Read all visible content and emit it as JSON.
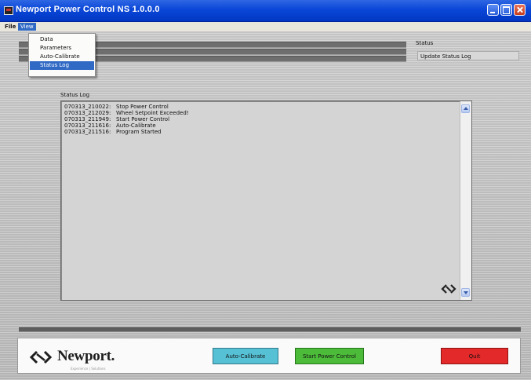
{
  "window": {
    "title": "Newport Power Control NS 1.0.0.0"
  },
  "menubar": {
    "file": "File",
    "view": "View"
  },
  "view_menu": {
    "items": [
      "Data",
      "Parameters",
      "Auto-Calibrate",
      "Status Log"
    ],
    "selected": "Status Log"
  },
  "status": {
    "label": "Status",
    "value": "Update Status Log"
  },
  "status_log": {
    "label": "Status Log",
    "entries": [
      {
        "time": "070313_210022:",
        "message": "Stop Power Control"
      },
      {
        "time": "070313_212029:",
        "message": "Wheel Setpoint Exceeded!"
      },
      {
        "time": "070313_211949:",
        "message": "Start Power Control"
      },
      {
        "time": "070313_211616:",
        "message": "Auto-Calibrate"
      },
      {
        "time": "070313_211516:",
        "message": "Program Started"
      }
    ]
  },
  "brand": {
    "name": "Newport.",
    "tagline": "Experience | Solutions"
  },
  "buttons": {
    "auto_calibrate": "Auto-Calibrate",
    "start_power_control": "Start Power Control",
    "quit": "Quit"
  },
  "colors": {
    "titlebar": "#0a46d8",
    "auto_calibrate": "#56c0d4",
    "start_power_control": "#4dbb3a",
    "quit": "#e4292a",
    "menu_highlight": "#316ac5"
  },
  "icons": [
    "app-icon",
    "minimize-icon",
    "maximize-icon",
    "close-icon",
    "scroll-up-icon",
    "scroll-down-icon",
    "newport-logo-icon"
  ]
}
